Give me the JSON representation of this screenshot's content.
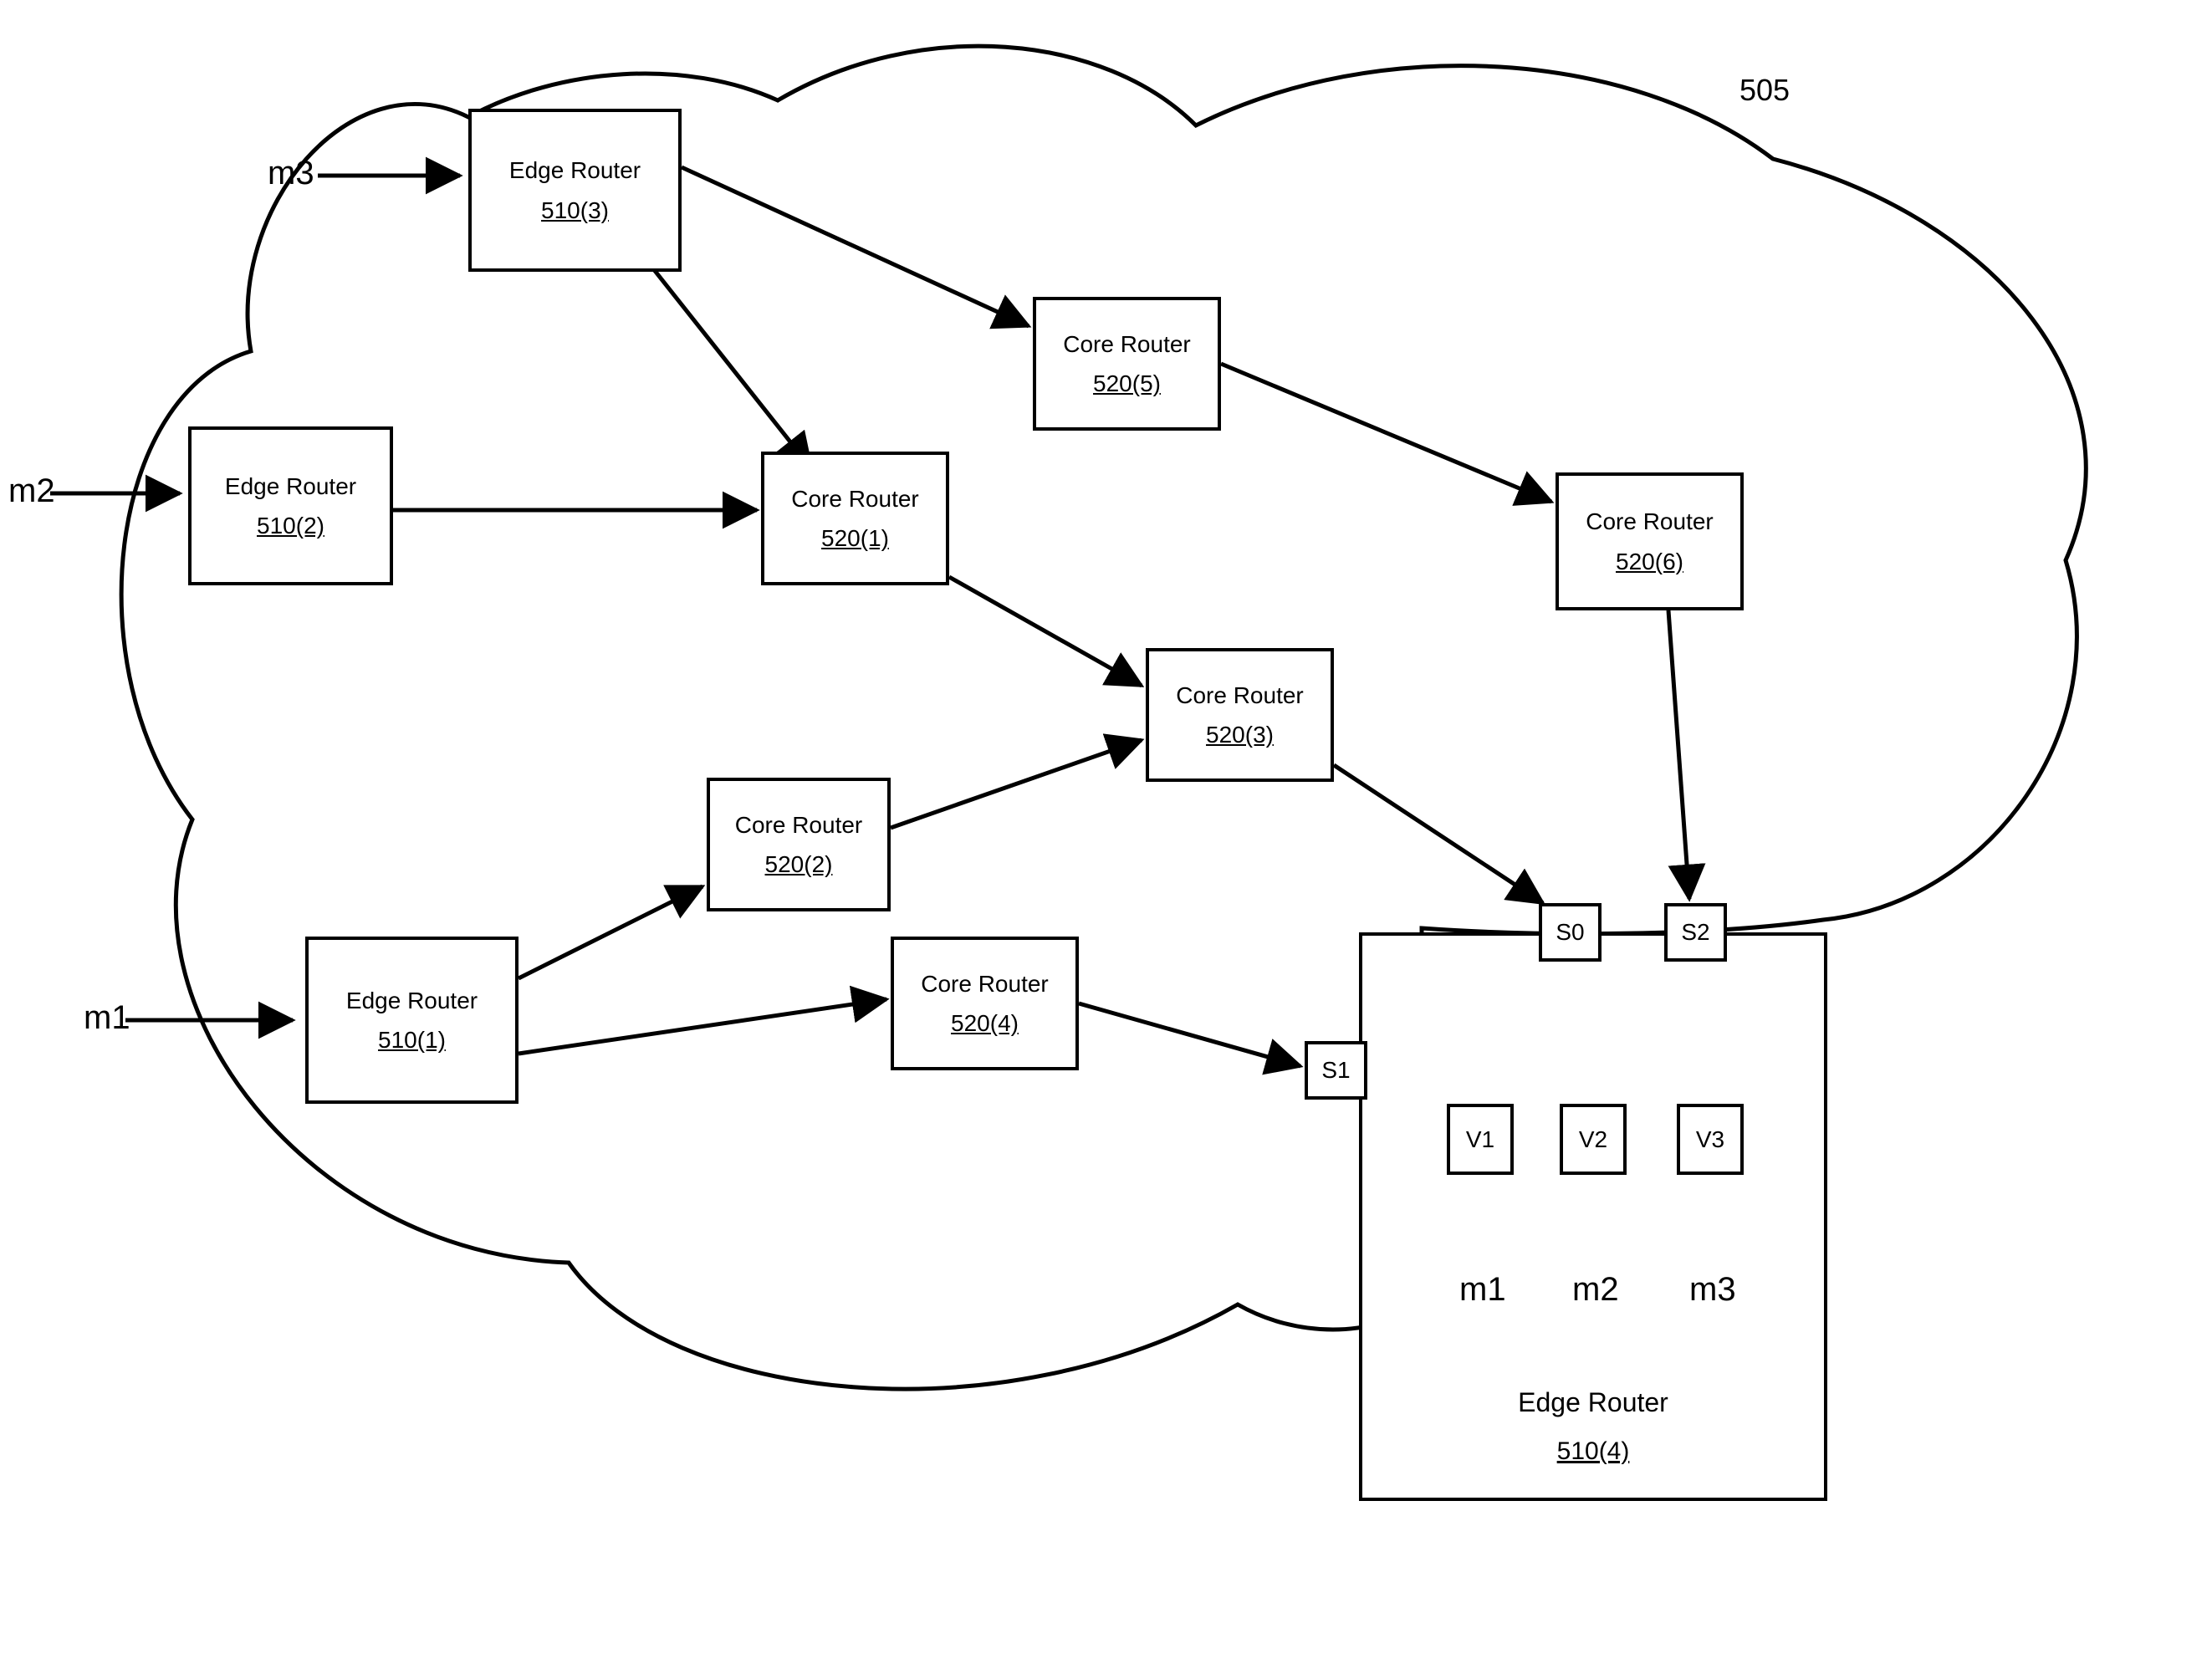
{
  "cloud": {
    "label": "505"
  },
  "inputs": {
    "m1": "m1",
    "m2": "m2",
    "m3": "m3"
  },
  "outputs": {
    "m1": "m1",
    "m2": "m2",
    "m3": "m3"
  },
  "edge_routers": {
    "er1": {
      "title": "Edge Router",
      "ref": "510(1)"
    },
    "er2": {
      "title": "Edge Router",
      "ref": "510(2)"
    },
    "er3": {
      "title": "Edge Router",
      "ref": "510(3)"
    },
    "er4": {
      "title": "Edge Router",
      "ref": "510(4)"
    }
  },
  "core_routers": {
    "cr1": {
      "title": "Core Router",
      "ref": "520(1)"
    },
    "cr2": {
      "title": "Core Router",
      "ref": "520(2)"
    },
    "cr3": {
      "title": "Core Router",
      "ref": "520(3)"
    },
    "cr4": {
      "title": "Core Router",
      "ref": "520(4)"
    },
    "cr5": {
      "title": "Core Router",
      "ref": "520(5)"
    },
    "cr6": {
      "title": "Core Router",
      "ref": "520(6)"
    }
  },
  "ports": {
    "s0": "S0",
    "s1": "S1",
    "s2": "S2",
    "v1": "V1",
    "v2": "V2",
    "v3": "V3"
  },
  "chart_data": {
    "type": "network-diagram",
    "cloud_id": "505",
    "nodes": [
      {
        "id": "510(1)",
        "type": "edge_router",
        "label": "Edge Router"
      },
      {
        "id": "510(2)",
        "type": "edge_router",
        "label": "Edge Router"
      },
      {
        "id": "510(3)",
        "type": "edge_router",
        "label": "Edge Router"
      },
      {
        "id": "510(4)",
        "type": "edge_router",
        "label": "Edge Router",
        "interfaces_in": [
          "S0",
          "S1",
          "S2"
        ],
        "interfaces_out": [
          "V1",
          "V2",
          "V3"
        ]
      },
      {
        "id": "520(1)",
        "type": "core_router",
        "label": "Core Router"
      },
      {
        "id": "520(2)",
        "type": "core_router",
        "label": "Core Router"
      },
      {
        "id": "520(3)",
        "type": "core_router",
        "label": "Core Router"
      },
      {
        "id": "520(4)",
        "type": "core_router",
        "label": "Core Router"
      },
      {
        "id": "520(5)",
        "type": "core_router",
        "label": "Core Router"
      },
      {
        "id": "520(6)",
        "type": "core_router",
        "label": "Core Router"
      }
    ],
    "external_inputs": [
      {
        "flow": "m1",
        "to": "510(1)"
      },
      {
        "flow": "m2",
        "to": "510(2)"
      },
      {
        "flow": "m3",
        "to": "510(3)"
      }
    ],
    "edges": [
      {
        "from": "510(3)",
        "to": "520(5)"
      },
      {
        "from": "510(3)",
        "to": "520(1)"
      },
      {
        "from": "510(2)",
        "to": "520(1)"
      },
      {
        "from": "520(5)",
        "to": "520(6)"
      },
      {
        "from": "520(1)",
        "to": "520(3)"
      },
      {
        "from": "510(1)",
        "to": "520(2)"
      },
      {
        "from": "510(1)",
        "to": "520(4)"
      },
      {
        "from": "520(2)",
        "to": "520(3)"
      },
      {
        "from": "520(4)",
        "to": "510(4)",
        "port": "S1"
      },
      {
        "from": "520(3)",
        "to": "510(4)",
        "port": "S0"
      },
      {
        "from": "520(6)",
        "to": "510(4)",
        "port": "S2"
      },
      {
        "from": "S0",
        "to": "V1"
      },
      {
        "from": "S0",
        "to": "V2"
      },
      {
        "from": "S0",
        "to": "V3"
      },
      {
        "from": "S1",
        "to": "V1"
      },
      {
        "from": "S2",
        "to": "V3"
      }
    ],
    "external_outputs": [
      {
        "flow": "m1",
        "from_port": "V1"
      },
      {
        "flow": "m2",
        "from_port": "V2"
      },
      {
        "flow": "m3",
        "from_port": "V3"
      }
    ]
  }
}
